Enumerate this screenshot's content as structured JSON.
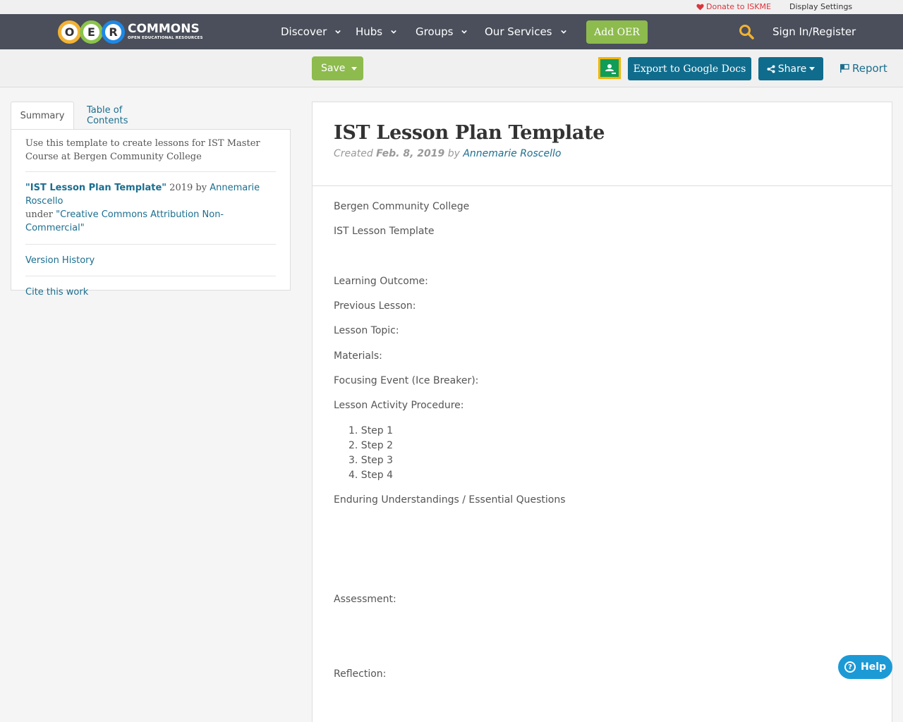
{
  "topbar": {
    "donate_label": "Donate to ISKME",
    "display_settings_label": "Display Settings"
  },
  "logo": {
    "letters": [
      "O",
      "E",
      "R"
    ],
    "name": "COMMONS",
    "tagline": "OPEN EDUCATIONAL RESOURCES"
  },
  "nav": {
    "items": [
      {
        "label": "Discover"
      },
      {
        "label": "Hubs"
      },
      {
        "label": "Groups"
      },
      {
        "label": "Our Services"
      }
    ],
    "add_oer_label": "Add OER",
    "signin_label": "Sign In/Register"
  },
  "toolbar": {
    "save_label": "Save",
    "export_label": "Export to Google Docs",
    "share_label": "Share",
    "report_label": "Report"
  },
  "sidebar": {
    "tabs": [
      {
        "label": "Summary",
        "active": true
      },
      {
        "label": "Table of Contents",
        "active": false
      }
    ],
    "summary": "Use this template to create lessons for IST Master Course at Bergen Community College",
    "license": {
      "title": "\"IST Lesson Plan Template\"",
      "year": " 2019 by ",
      "author": "Annemarie Roscello",
      "under": "under ",
      "license_name": "\"Creative Commons Attribution Non-Commercial\""
    },
    "version_history_label": "Version History",
    "cite_label": "Cite this work"
  },
  "main": {
    "title": "IST Lesson Plan Template",
    "created_label": "Created ",
    "date": "Feb. 8, 2019",
    "by_label": " by ",
    "author": "Annemarie Roscello",
    "paragraphs": [
      "Bergen Community College",
      "IST Lesson Template",
      "Learning Outcome:",
      "Previous Lesson:",
      "Lesson Topic:",
      "Materials:",
      "Focusing Event (Ice Breaker):",
      "Lesson Activity Procedure:",
      "Enduring Understandings / Essential Questions",
      "Assessment:",
      "Reflection:"
    ],
    "steps": [
      "1. Step 1",
      "2. Step 2",
      "3. Step 3",
      "4. Step 4"
    ]
  },
  "help": {
    "label": "Help"
  },
  "colors": {
    "navbar": "#4a4f5b",
    "green": "#8dbb4d",
    "teal": "#0f6c8c",
    "link": "#1b6e8f",
    "help": "#1c9ad6"
  }
}
